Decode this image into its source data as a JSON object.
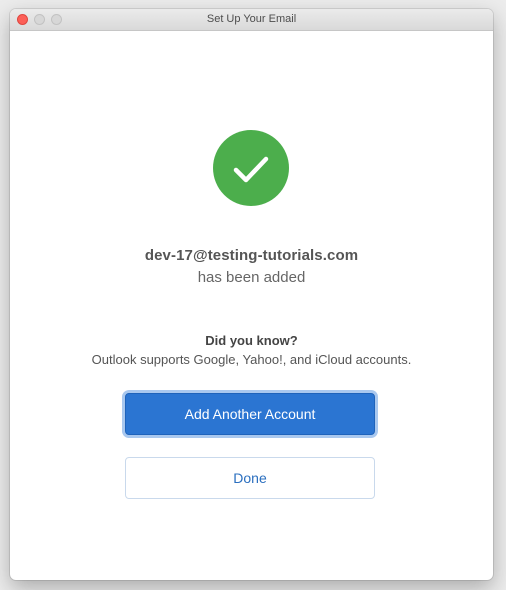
{
  "window": {
    "title": "Set Up Your Email"
  },
  "icons": {
    "success": "checkmark-circle-icon"
  },
  "message": {
    "email": "dev-17@testing-tutorials.com",
    "status": "has been added"
  },
  "tip": {
    "title": "Did you know?",
    "text": "Outlook supports Google, Yahoo!, and iCloud accounts."
  },
  "buttons": {
    "add_another": "Add Another Account",
    "done": "Done"
  },
  "colors": {
    "success_green": "#4cae4c",
    "primary_blue": "#2b75d2",
    "focus_ring": "#a9c8ef",
    "close_red": "#fc5f57"
  }
}
